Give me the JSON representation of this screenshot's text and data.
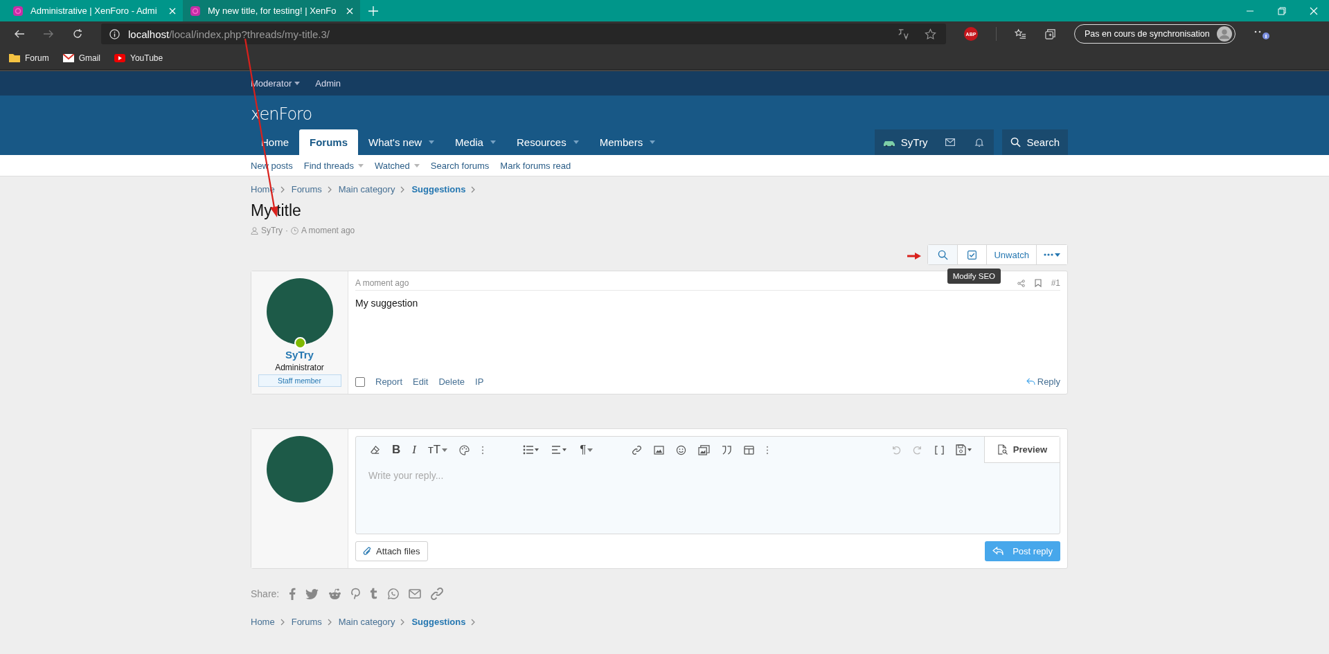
{
  "browser": {
    "tabs": [
      {
        "title": "Administrative | XenForo - Admi",
        "selected": false
      },
      {
        "title": "My new title, for testing! | XenFo",
        "selected": true
      }
    ],
    "address": {
      "host": "localhost",
      "path": "/local/index.php?threads/my-title.3/"
    },
    "adblock_badge": "ABP",
    "profile_button": "Pas en cours de synchronisation",
    "bookmarks": [
      {
        "label": "Forum",
        "kind": "folder"
      },
      {
        "label": "Gmail",
        "kind": "mail"
      },
      {
        "label": "YouTube",
        "kind": "video"
      }
    ]
  },
  "staff_bar": [
    {
      "label": "Moderator",
      "has_menu": true
    },
    {
      "label": "Admin",
      "has_menu": false
    }
  ],
  "logo": "xenForo",
  "nav": [
    {
      "label": "Home",
      "selected": false,
      "has_menu": false
    },
    {
      "label": "Forums",
      "selected": true,
      "has_menu": false
    },
    {
      "label": "What's new",
      "selected": false,
      "has_menu": true
    },
    {
      "label": "Media",
      "selected": false,
      "has_menu": true
    },
    {
      "label": "Resources",
      "selected": false,
      "has_menu": true
    },
    {
      "label": "Members",
      "selected": false,
      "has_menu": true
    }
  ],
  "user_nav": {
    "username": "SyTry",
    "search": "Search"
  },
  "subnav": [
    {
      "label": "New posts",
      "has_menu": false
    },
    {
      "label": "Find threads",
      "has_menu": true
    },
    {
      "label": "Watched",
      "has_menu": true
    },
    {
      "label": "Search forums",
      "has_menu": false
    },
    {
      "label": "Mark forums read",
      "has_menu": false
    }
  ],
  "breadcrumb": [
    {
      "label": "Home",
      "current": false
    },
    {
      "label": "Forums",
      "current": false
    },
    {
      "label": "Main category",
      "current": false
    },
    {
      "label": "Suggestions",
      "current": true
    }
  ],
  "thread": {
    "title": "My title",
    "author": "SyTry",
    "separator": "·",
    "time": "A moment ago"
  },
  "thread_actions": {
    "unwatch": "Unwatch",
    "tooltip": "Modify SEO"
  },
  "post": {
    "time": "A moment ago",
    "number": "#1",
    "body": "My suggestion",
    "checked": false,
    "user": {
      "name": "SyTry",
      "title": "Administrator",
      "banner": "Staff member",
      "online": true
    },
    "actions": [
      "Report",
      "Edit",
      "Delete",
      "IP"
    ],
    "reply": "Reply"
  },
  "editor": {
    "glyphs": {
      "bold": "B",
      "italic": "I",
      "size": "тT",
      "paragraph": "¶"
    },
    "placeholder": "Write your reply...",
    "preview": "Preview",
    "attach": "Attach files",
    "post": "Post reply"
  },
  "share": {
    "label": "Share:"
  },
  "breadcrumb_bottom": [
    {
      "label": "Home",
      "current": false
    },
    {
      "label": "Forums",
      "current": false
    },
    {
      "label": "Main category",
      "current": false
    },
    {
      "label": "Suggestions",
      "current": true
    }
  ]
}
